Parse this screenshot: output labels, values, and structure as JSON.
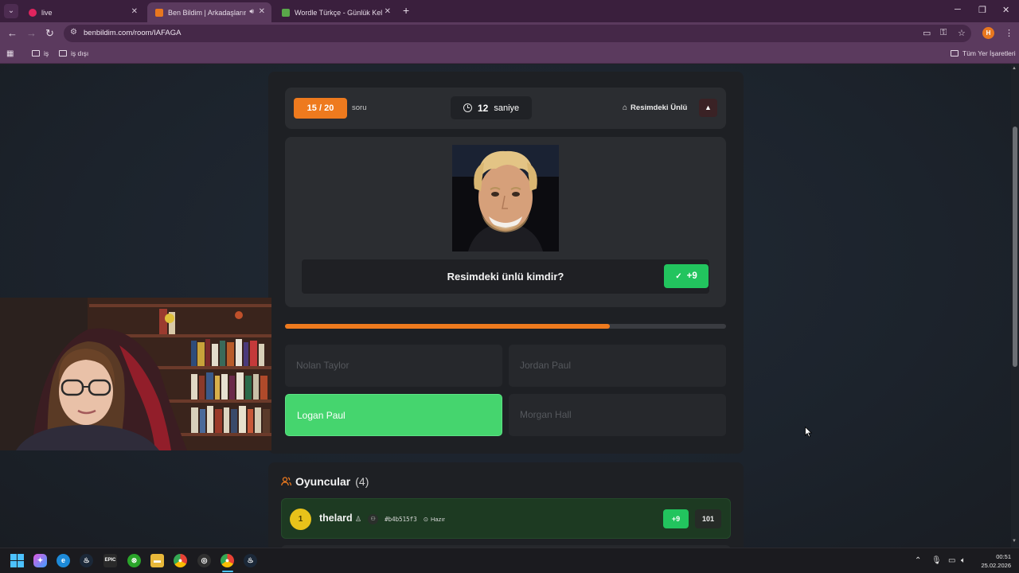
{
  "browser": {
    "tabs": [
      {
        "title": "live",
        "active": false,
        "favicon_color": "#e0245e"
      },
      {
        "title": "Ben Bildim | Arkadaşlarınla",
        "active": true,
        "favicon_color": "#e8771f"
      },
      {
        "title": "Wordle Türkçe - Günlük Kelime",
        "active": false,
        "favicon_color": "#5aa84a"
      }
    ],
    "url": "benbildim.com/room/IAFAGA",
    "profile_initial": "H",
    "bookmarks": [
      "iş",
      "iş dışı"
    ],
    "all_bookmarks": "Tüm Yer İşaretleri"
  },
  "quiz": {
    "question_counter": "15 / 20",
    "question_counter_label": "soru",
    "timer_value": "12",
    "timer_unit": "saniye",
    "category": "Resimdeki Ünlü",
    "question": "Resimdeki ünlü kimdir?",
    "points": "+9",
    "progress": 0.736,
    "options": [
      {
        "label": "Nolan Taylor",
        "state": "disabled"
      },
      {
        "label": "Jordan Paul",
        "state": "disabled"
      },
      {
        "label": "Logan Paul",
        "state": "correct"
      },
      {
        "label": "Morgan Hall",
        "state": "disabled"
      }
    ],
    "accent_color": "#ee7a1e",
    "correct_color": "#45d56e"
  },
  "players": {
    "title": "Oyuncular",
    "count": "(4)",
    "list": [
      {
        "rank": "1",
        "name": "thelard",
        "hash": "#b4b515f3",
        "status": "Hazır",
        "gain": "+9",
        "score": "101"
      }
    ]
  },
  "taskbar": {
    "time": "00:51",
    "date": "25.02.2026"
  }
}
